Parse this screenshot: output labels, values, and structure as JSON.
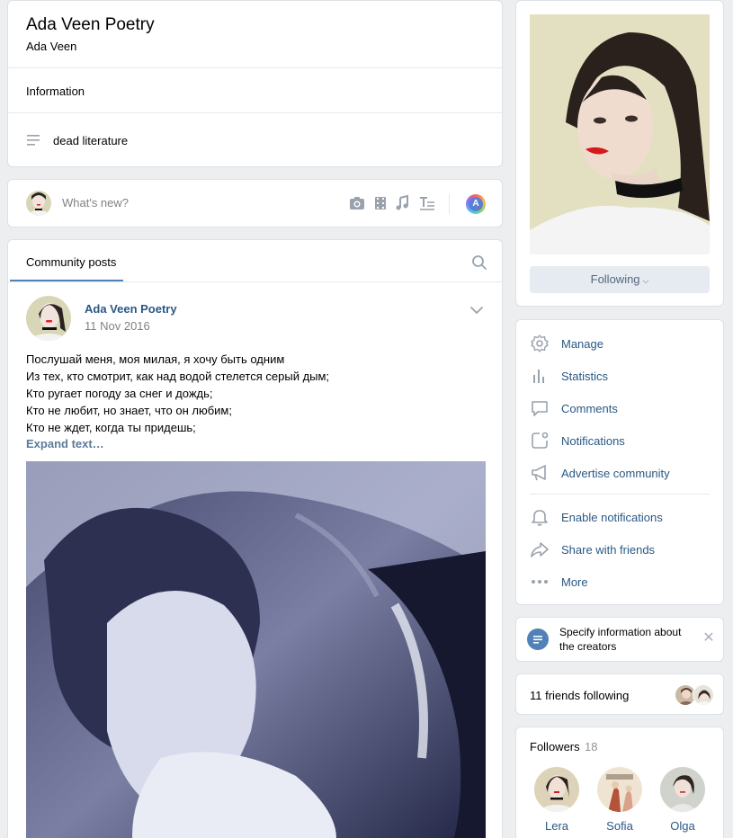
{
  "header": {
    "title": "Ada Veen Poetry",
    "subtitle": "Ada Veen",
    "info_label": "Information",
    "status": "dead literature"
  },
  "composer": {
    "placeholder": "What's new?",
    "author_initial": "A"
  },
  "posts": {
    "tab_label": "Community posts",
    "post": {
      "author": "Ada Veen Poetry",
      "date": "11 Nov 2016",
      "lines": [
        "Послушай меня, моя милая, я хочу быть одним",
        "Из тех, кто смотрит, как над водой стелется серый дым;",
        "Кто ругает погоду за снег и дождь;",
        "Кто не любит, но знает, что он любим;",
        "Кто не ждет, когда ты придешь;"
      ],
      "expand_label": "Expand text…"
    }
  },
  "profile": {
    "following_label": "Following"
  },
  "menu": {
    "items": [
      {
        "label": "Manage",
        "icon": "gear-icon"
      },
      {
        "label": "Statistics",
        "icon": "bar-chart-icon"
      },
      {
        "label": "Comments",
        "icon": "comment-icon"
      },
      {
        "label": "Notifications",
        "icon": "notification-icon"
      },
      {
        "label": "Advertise community",
        "icon": "megaphone-icon"
      },
      {
        "label": "Enable notifications",
        "icon": "bell-icon"
      },
      {
        "label": "Share with friends",
        "icon": "share-icon"
      },
      {
        "label": "More",
        "icon": "more-dots-icon"
      }
    ]
  },
  "notice": {
    "text": "Specify information about the creators"
  },
  "friends": {
    "text": "11 friends following"
  },
  "followers": {
    "title": "Followers",
    "count": "18",
    "items": [
      {
        "name": "Lera"
      },
      {
        "name": "Sofia"
      },
      {
        "name": "Olga"
      }
    ]
  },
  "colors": {
    "link": "#2a5885",
    "accent": "#5181b8",
    "icon": "#99a2ad",
    "background": "#edeef0"
  }
}
